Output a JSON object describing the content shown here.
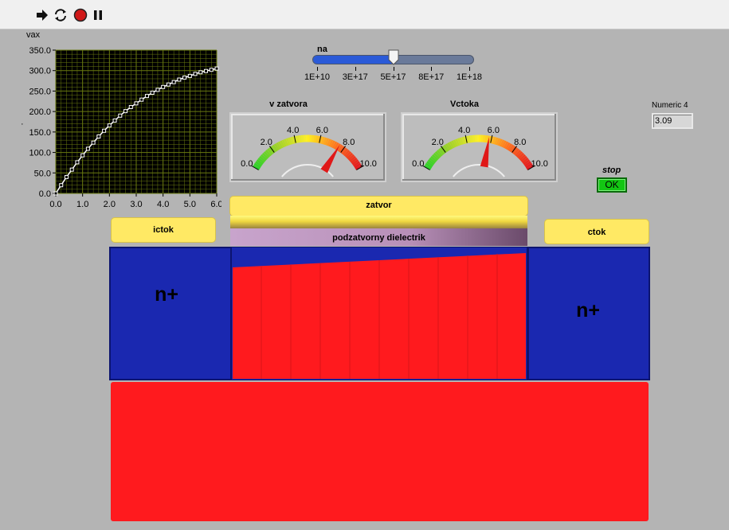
{
  "toolbar": {
    "buttons": [
      {
        "name": "run-arrow-icon"
      },
      {
        "name": "run-continuously-icon"
      },
      {
        "name": "abort-icon"
      },
      {
        "name": "pause-icon"
      }
    ]
  },
  "graph": {
    "ylabel": "vax",
    "y_ticks": [
      "350.0",
      "300.0",
      "250.0",
      "200.0",
      "150.0",
      "100.0",
      "50.0",
      "0.0"
    ],
    "x_ticks": [
      "0.0",
      "1.0",
      "2.0",
      "3.0",
      "4.0",
      "5.0",
      "6.0"
    ],
    "colors": {
      "plot_bg": "#000000",
      "grid": "#6a7a10",
      "trace": "#ffffff"
    }
  },
  "chart_data": {
    "type": "line",
    "xlabel": "",
    "ylabel": "vax",
    "xlim": [
      0,
      6
    ],
    "ylim": [
      0,
      350
    ],
    "grid": true,
    "x": [
      0.0,
      0.2,
      0.4,
      0.6,
      0.8,
      1.0,
      1.2,
      1.4,
      1.6,
      1.8,
      2.0,
      2.2,
      2.4,
      2.6,
      2.8,
      3.0,
      3.2,
      3.4,
      3.6,
      3.8,
      4.0,
      4.2,
      4.4,
      4.6,
      4.8,
      5.0,
      5.2,
      5.4,
      5.6,
      5.8,
      6.0
    ],
    "y": [
      0,
      20,
      40,
      58,
      76,
      93,
      109,
      124,
      139,
      153,
      166,
      178,
      190,
      201,
      211,
      220,
      229,
      238,
      246,
      253,
      260,
      266,
      272,
      278,
      283,
      287,
      292,
      296,
      299,
      302,
      305
    ]
  },
  "slider": {
    "label": "na",
    "ticks": [
      "1E+10",
      "3E+17",
      "5E+17",
      "8E+17",
      "1E+18"
    ],
    "value_fraction": 0.5,
    "colors": {
      "fill": "#2a5ad8",
      "track": "#6a7a9a"
    }
  },
  "gauges": [
    {
      "title": "v zatvora",
      "ticks": [
        "0.0",
        "2.0",
        "4.0",
        "6.0",
        "8.0",
        "10.0"
      ],
      "min": 0,
      "max": 10,
      "value": 7.6
    },
    {
      "title": "Vctoka",
      "ticks": [
        "0.0",
        "2.0",
        "4.0",
        "6.0",
        "8.0",
        "10.0"
      ],
      "min": 0,
      "max": 10,
      "value": 5.8
    }
  ],
  "numeric": {
    "label": "Numeric 4",
    "value": "3.09"
  },
  "stop": {
    "label": "stop",
    "button_label": "OK"
  },
  "device": {
    "gate_label": "zatvor",
    "dielectric_label": "podzatvorny dielectrik",
    "source_label": "ictok",
    "drain_label": "ctok",
    "nplus_left": "n+",
    "nplus_right": "n+",
    "colors": {
      "nplus": "#1a28b0",
      "substrate": "#ff1a1e",
      "gate": "#ffe964",
      "dielectric": "#c49cc8"
    }
  }
}
